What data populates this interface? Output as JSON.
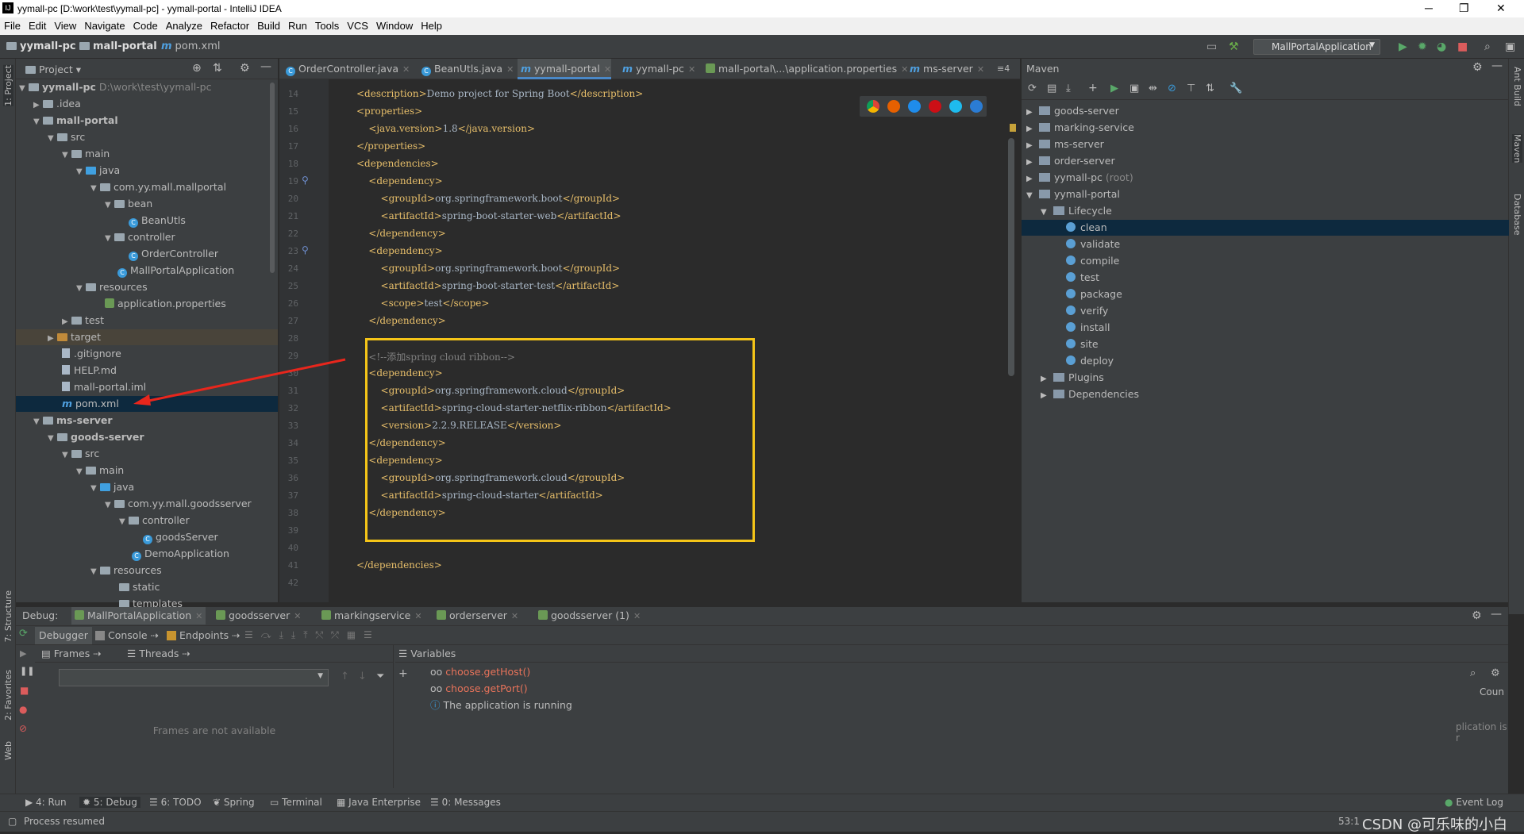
{
  "window": {
    "title": "yymall-pc [D:\\work\\test\\yymall-pc] - yymall-portal - IntelliJ IDEA",
    "minimize": "─",
    "maximize": "❐",
    "close": "✕"
  },
  "menu": [
    "File",
    "Edit",
    "View",
    "Navigate",
    "Code",
    "Analyze",
    "Refactor",
    "Build",
    "Run",
    "Tools",
    "VCS",
    "Window",
    "Help"
  ],
  "breadcrumb": {
    "root": "yymall-pc",
    "module": "mall-portal",
    "file": "pom.xml"
  },
  "run_config": "MallPortalApplication",
  "project": {
    "title": "Project",
    "items": [
      {
        "label": "yymall-pc",
        "extra": "D:\\work\\test\\yymall-pc"
      },
      {
        "label": ".idea"
      },
      {
        "label": "mall-portal"
      },
      {
        "label": "src"
      },
      {
        "label": "main"
      },
      {
        "label": "java"
      },
      {
        "label": "com.yy.mall.mallportal"
      },
      {
        "label": "bean"
      },
      {
        "label": "BeanUtls"
      },
      {
        "label": "controller"
      },
      {
        "label": "OrderController"
      },
      {
        "label": "MallPortalApplication"
      },
      {
        "label": "resources"
      },
      {
        "label": "application.properties"
      },
      {
        "label": "test"
      },
      {
        "label": "target"
      },
      {
        "label": ".gitignore"
      },
      {
        "label": "HELP.md"
      },
      {
        "label": "mall-portal.iml"
      },
      {
        "label": "pom.xml"
      },
      {
        "label": "ms-server"
      },
      {
        "label": "goods-server"
      },
      {
        "label": "src"
      },
      {
        "label": "main"
      },
      {
        "label": "java"
      },
      {
        "label": "com.yy.mall.goodsserver"
      },
      {
        "label": "controller"
      },
      {
        "label": "goodsServer"
      },
      {
        "label": "DemoApplication"
      },
      {
        "label": "resources"
      },
      {
        "label": "static"
      },
      {
        "label": "templates"
      }
    ]
  },
  "tabs": [
    {
      "label": "OrderController.java"
    },
    {
      "label": "BeanUtls.java"
    },
    {
      "label": "yymall-portal"
    },
    {
      "label": "yymall-pc"
    },
    {
      "label": "mall-portal\\...\\application.properties"
    },
    {
      "label": "ms-server"
    },
    {
      "label": "≡4"
    }
  ],
  "editor": {
    "lines": [
      {
        "n": "14",
        "t": "<description>Demo project for Spring Boot</description>"
      },
      {
        "n": "15",
        "t": "<properties>"
      },
      {
        "n": "16",
        "t": "    <java.version>1.8</java.version>"
      },
      {
        "n": "17",
        "t": "</properties>"
      },
      {
        "n": "18",
        "t": "<dependencies>"
      },
      {
        "n": "19",
        "t": "    <dependency>"
      },
      {
        "n": "20",
        "t": "        <groupId>org.springframework.boot</groupId>"
      },
      {
        "n": "21",
        "t": "        <artifactId>spring-boot-starter-web</artifactId>"
      },
      {
        "n": "22",
        "t": "    </dependency>"
      },
      {
        "n": "23",
        "t": "    <dependency>"
      },
      {
        "n": "24",
        "t": "        <groupId>org.springframework.boot</groupId>"
      },
      {
        "n": "25",
        "t": "        <artifactId>spring-boot-starter-test</artifactId>"
      },
      {
        "n": "26",
        "t": "        <scope>test</scope>"
      },
      {
        "n": "27",
        "t": "    </dependency>"
      },
      {
        "n": "28",
        "t": ""
      },
      {
        "n": "29",
        "t": "    <!--添加spring cloud ribbon-->"
      },
      {
        "n": "30",
        "t": "    <dependency>"
      },
      {
        "n": "31",
        "t": "        <groupId>org.springframework.cloud</groupId>"
      },
      {
        "n": "32",
        "t": "        <artifactId>spring-cloud-starter-netflix-ribbon</artifactId>"
      },
      {
        "n": "33",
        "t": "        <version>2.2.9.RELEASE</version>"
      },
      {
        "n": "34",
        "t": "    </dependency>"
      },
      {
        "n": "35",
        "t": "    <dependency>"
      },
      {
        "n": "36",
        "t": "        <groupId>org.springframework.cloud</groupId>"
      },
      {
        "n": "37",
        "t": "        <artifactId>spring-cloud-starter</artifactId>"
      },
      {
        "n": "38",
        "t": "    </dependency>"
      },
      {
        "n": "39",
        "t": ""
      },
      {
        "n": "40",
        "t": ""
      },
      {
        "n": "41",
        "t": "</dependencies>"
      },
      {
        "n": "42",
        "t": ""
      }
    ]
  },
  "maven": {
    "title": "Maven",
    "items": [
      {
        "label": "goods-server"
      },
      {
        "label": "marking-service"
      },
      {
        "label": "ms-server"
      },
      {
        "label": "order-server"
      },
      {
        "label": "yymall-pc",
        "extra": "(root)"
      },
      {
        "label": "yymall-portal"
      },
      {
        "label": "Lifecycle"
      },
      {
        "label": "clean"
      },
      {
        "label": "validate"
      },
      {
        "label": "compile"
      },
      {
        "label": "test"
      },
      {
        "label": "package"
      },
      {
        "label": "verify"
      },
      {
        "label": "install"
      },
      {
        "label": "site"
      },
      {
        "label": "deploy"
      },
      {
        "label": "Plugins"
      },
      {
        "label": "Dependencies"
      }
    ]
  },
  "debug": {
    "label": "Debug:",
    "sessions": [
      "MallPortalApplication",
      "goodsserver",
      "markingservice",
      "orderserver",
      "goodsserver (1)"
    ],
    "subtabs": [
      "Debugger",
      "Console",
      "Endpoints"
    ],
    "frames_label": "Frames",
    "threads_label": "Threads",
    "variables_label": "Variables",
    "frames_empty": "Frames are not available",
    "variables": [
      "choose.getHost()",
      "choose.getPort()",
      "The application is running"
    ],
    "right_partial": [
      "Coun",
      "plication is r"
    ]
  },
  "bottom_tools": [
    "4: Run",
    "5: Debug",
    "6: TODO",
    "Spring",
    "Terminal",
    "Java Enterprise",
    "0: Messages"
  ],
  "event_log": "Event Log",
  "status": {
    "text": "Process resumed",
    "position": "53:1",
    "watermark": "CSDN @可乐味的小白"
  },
  "side_left": [
    "1: Project",
    "7: Structure",
    "2: Favorites",
    "Web"
  ],
  "side_right": [
    "Ant Build",
    "Maven",
    "Database"
  ]
}
